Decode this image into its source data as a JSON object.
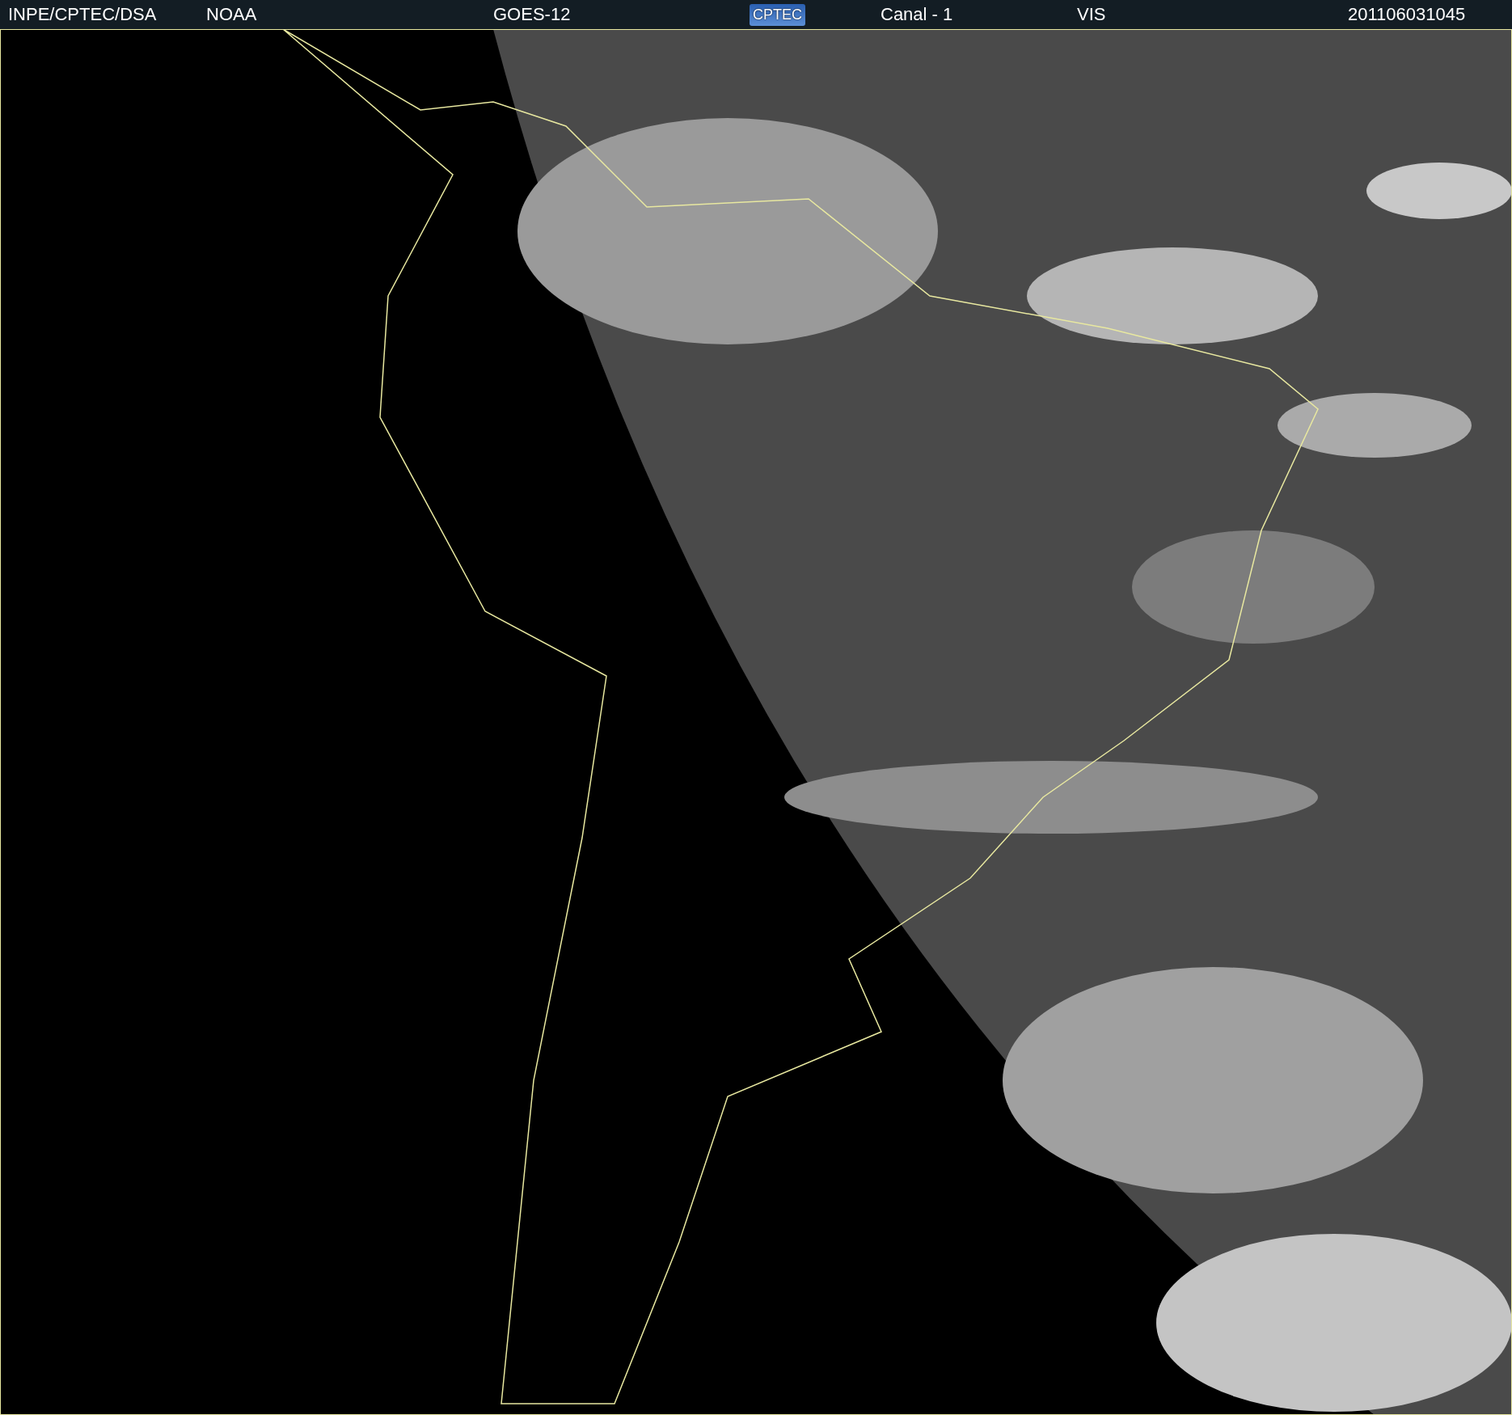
{
  "header": {
    "items": [
      {
        "kind": "text",
        "text": "INPE/CPTEC/DSA"
      },
      {
        "kind": "text",
        "text": "NOAA"
      },
      {
        "kind": "text",
        "text": "GOES-12"
      },
      {
        "kind": "logo",
        "text": "CPTEC"
      },
      {
        "kind": "text",
        "text": "Canal - 1"
      },
      {
        "kind": "text",
        "text": "VIS"
      },
      {
        "kind": "text",
        "text": "201106031045"
      }
    ]
  }
}
